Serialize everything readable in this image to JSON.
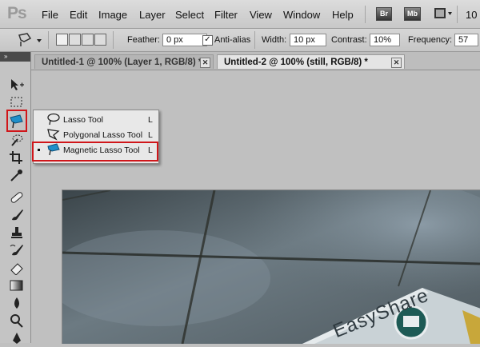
{
  "app": {
    "logo": "Ps"
  },
  "menubar": {
    "items": [
      "File",
      "Edit",
      "Image",
      "Layer",
      "Select",
      "Filter",
      "View",
      "Window",
      "Help"
    ],
    "bridge": "Br",
    "mini_bridge": "Mb",
    "zoom_partial": "10"
  },
  "options": {
    "feather_label": "Feather:",
    "feather_value": "0 px",
    "antialias_label": "Anti-alias",
    "antialias_checked": true,
    "width_label": "Width:",
    "width_value": "10 px",
    "contrast_label": "Contrast:",
    "contrast_value": "10%",
    "frequency_label": "Frequency:",
    "frequency_value": "57"
  },
  "tabs": [
    {
      "title": "Untitled-1 @ 100% (Layer 1, RGB/8) *",
      "active": false
    },
    {
      "title": "Untitled-2 @ 100% (still, RGB/8) *",
      "active": true
    }
  ],
  "toolbox": {
    "collapse_glyph": "»"
  },
  "flyout": {
    "items": [
      {
        "label": "Lasso Tool",
        "shortcut": "L",
        "selected": false
      },
      {
        "label": "Polygonal Lasso Tool",
        "shortcut": "L",
        "selected": false
      },
      {
        "label": "Magnetic Lasso Tool",
        "shortcut": "L",
        "selected": true
      }
    ]
  },
  "photo": {
    "box_text": "EasyShare"
  },
  "colors": {
    "highlight": "#d0161a",
    "magnetic_icon": "#1f8fc9"
  }
}
